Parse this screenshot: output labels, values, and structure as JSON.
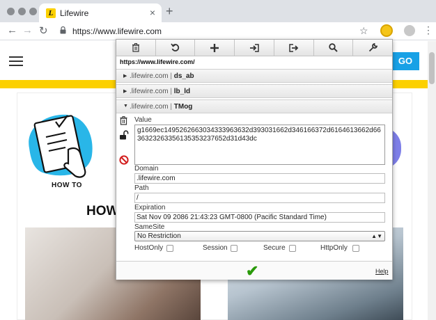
{
  "browser": {
    "tab_title": "Lifewire",
    "tab_logo_letter": "L",
    "tab_close": "×",
    "new_tab": "+",
    "url": "https://www.lifewire.com",
    "back": "←",
    "forward": "→",
    "reload": "↻",
    "star": "☆",
    "menu": "⋮"
  },
  "page": {
    "go_label": "GO",
    "howto_label": "HOW TO",
    "howto_heading": "HOW",
    "colors": {
      "accent_yellow": "#fcd000",
      "go_blue": "#18a1e6"
    }
  },
  "popup": {
    "toolbar": [
      {
        "icon": "trash-icon",
        "glyph": "🗑"
      },
      {
        "icon": "undo-icon",
        "glyph": "↻"
      },
      {
        "icon": "add-icon",
        "glyph": "+"
      },
      {
        "icon": "import-icon",
        "glyph": "⇥"
      },
      {
        "icon": "export-icon",
        "glyph": "⇨"
      },
      {
        "icon": "search-icon",
        "glyph": "⌕"
      },
      {
        "icon": "wrench-icon",
        "glyph": "🔧"
      }
    ],
    "page_url": "https://www.lifewire.com/",
    "cookies": [
      {
        "domain": ".lifewire.com",
        "name": "ds_ab",
        "expanded": false
      },
      {
        "domain": ".lifewire.com",
        "name": "lb_ld",
        "expanded": false
      },
      {
        "domain": ".lifewire.com",
        "name": "TMog",
        "expanded": true
      }
    ],
    "separator": "|",
    "labels": {
      "value": "Value",
      "domain": "Domain",
      "path": "Path",
      "expiration": "Expiration",
      "samesite": "SameSite",
      "hostonly": "HostOnly",
      "session": "Session",
      "secure": "Secure",
      "httponly": "HttpOnly",
      "help": "Help"
    },
    "fields": {
      "value": "g1669ec1495262663034333963632d393031662d346166372d6164613662d6636323263356135353237652d31d43dc",
      "domain": ".lifewire.com",
      "path": "/",
      "expiration": "Sat Nov 09 2086 21:43:23 GMT-0800 (Pacific Standard Time)",
      "samesite": "No Restriction"
    },
    "checkboxes": {
      "hostonly": false,
      "session": false,
      "secure": false,
      "httponly": false
    }
  }
}
